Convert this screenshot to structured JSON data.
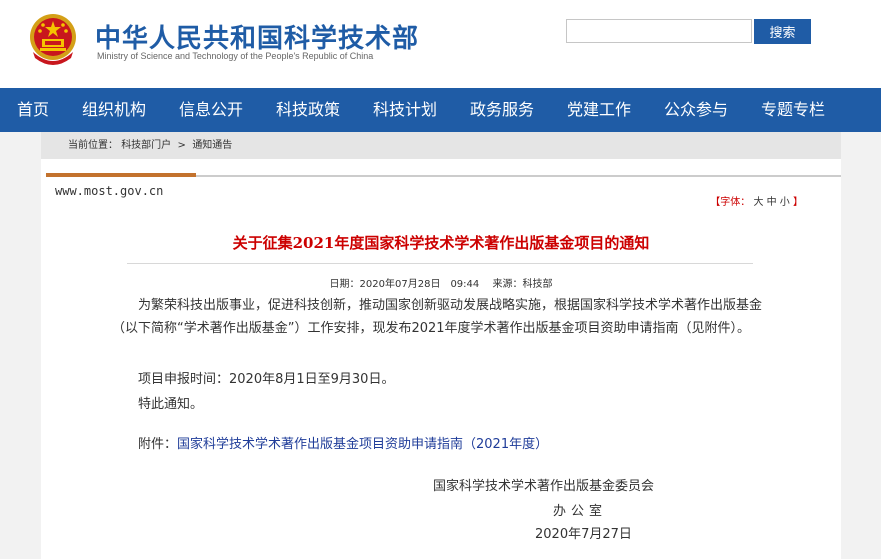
{
  "header": {
    "title": "中华人民共和国科学技术部",
    "subtitle": "Ministry of Science and Technology of the People's Republic of China",
    "search_button": "搜索",
    "search_value": ""
  },
  "nav": {
    "items": [
      "首页",
      "组织机构",
      "信息公开",
      "科技政策",
      "科技计划",
      "政务服务",
      "党建工作",
      "公众参与",
      "专题专栏"
    ]
  },
  "breadcrumb": {
    "label": "当前位置：",
    "home": "科技部门户",
    "sep": " > ",
    "current": "通知通告"
  },
  "article": {
    "domain": "www.most.gov.cn",
    "font_size_label": "【字体：",
    "font_sizes": "大 中 小",
    "font_size_close": "】",
    "title": "关于征集2021年度国家科学技术学术著作出版基金项目的通知",
    "date": "日期：2020年07月28日　09:44",
    "source": "来源：科技部",
    "paragraph1": "为繁荣科技出版事业，促进科技创新，推动国家创新驱动发展战略实施，根据国家科学技术学术著作出版基金（以下简称“学术著作出版基金”）工作安排，现发布2021年度学术著作出版基金项目资助申请指南（见附件）。",
    "paragraph2": "项目申报时间：2020年8月1日至9月30日。",
    "paragraph3": "特此通知。",
    "attachment_label": "附件：",
    "attachment_link": "国家科学技术学术著作出版基金项目资助申请指南（2021年度）",
    "sign_org": "国家科学技术学术著作出版基金委员会",
    "sign_office": "办公室",
    "sign_date": "2020年7月27日"
  },
  "colors": {
    "brand_blue": "#1f5ca6",
    "title_red": "#cc0000",
    "accent_orange": "#c3722d"
  }
}
